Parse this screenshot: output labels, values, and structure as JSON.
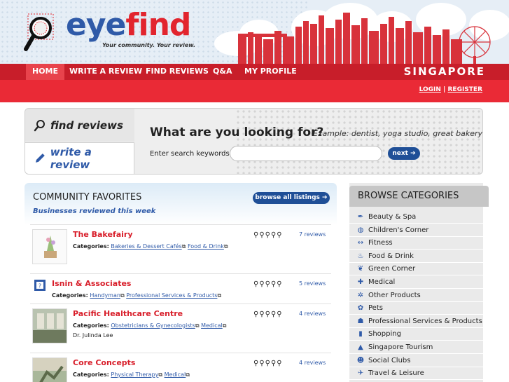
{
  "brand": {
    "logo_eye": "eye",
    "logo_find": "find",
    "tagline": "Your community. Your review.",
    "city": "SINGAPORE"
  },
  "nav": {
    "items": [
      {
        "label": "HOME",
        "active": true
      },
      {
        "label": "WRITE A REVIEW"
      },
      {
        "label": "FIND REVIEWS"
      },
      {
        "label": "Q&A"
      },
      {
        "label": "MY PROFILE"
      }
    ]
  },
  "auth": {
    "login": "LOGIN",
    "separator": "|",
    "register": "REGISTER"
  },
  "search": {
    "tab_find": "find reviews",
    "tab_write": "write a review",
    "heading": "What are you looking for?",
    "example": "Example: dentist, yoga studio, great bakery",
    "keywords_label": "Enter search keywords",
    "input_value": "",
    "next_label": "next ➔"
  },
  "favorites": {
    "title": "COMMUNITY FAVORITES",
    "subtitle": "Businesses reviewed this week",
    "browse_all": "browse all listings ➔",
    "categories_label": "Categories:",
    "listings": [
      {
        "name": "The Bakefairy",
        "categories": [
          "Bakeries & Dessert Cafés",
          "Food & Drink"
        ],
        "extra": "",
        "rating": "⚲⚲⚲⚲⚲",
        "reviews": "7 reviews"
      },
      {
        "name": "Isnin & Associates",
        "categories": [
          "Handyman",
          "Professional Services & Products"
        ],
        "extra": "",
        "rating": "⚲⚲⚲⚲⚲",
        "reviews": "5 reviews"
      },
      {
        "name": "Pacific Healthcare Centre",
        "categories": [
          "Obstetricians & Gynecologists",
          "Medical"
        ],
        "extra": "Dr. Julinda Lee",
        "rating": "⚲⚲⚲⚲⚲",
        "reviews": "4 reviews"
      },
      {
        "name": "Core Concepts",
        "categories": [
          "Physical Therapy",
          "Medical"
        ],
        "extra": "",
        "rating": "⚲⚲⚲⚲⚲",
        "reviews": "4 reviews"
      }
    ]
  },
  "browse": {
    "title": "BROWSE CATEGORIES",
    "items": [
      {
        "label": "Beauty & Spa",
        "icon": "✒",
        "icon_name": "pen-icon"
      },
      {
        "label": "Children's Corner",
        "icon": "◍",
        "icon_name": "ball-icon"
      },
      {
        "label": "Fitness",
        "icon": "↔",
        "icon_name": "dumbbell-icon"
      },
      {
        "label": "Food & Drink",
        "icon": "♨",
        "icon_name": "cutlery-icon"
      },
      {
        "label": "Green Corner",
        "icon": "❦",
        "icon_name": "leaf-icon"
      },
      {
        "label": "Medical",
        "icon": "✚",
        "icon_name": "cross-icon"
      },
      {
        "label": "Other Products",
        "icon": "✲",
        "icon_name": "gear-icon"
      },
      {
        "label": "Pets",
        "icon": "✿",
        "icon_name": "paw-icon"
      },
      {
        "label": "Professional Services & Products",
        "icon": "☗",
        "icon_name": "person-icon"
      },
      {
        "label": "Shopping",
        "icon": "▮",
        "icon_name": "bag-icon"
      },
      {
        "label": "Singapore Tourism",
        "icon": "▲",
        "icon_name": "landmark-icon"
      },
      {
        "label": "Social Clubs",
        "icon": "☻",
        "icon_name": "people-icon"
      },
      {
        "label": "Travel & Leisure",
        "icon": "✈",
        "icon_name": "plane-icon"
      }
    ]
  },
  "colors": {
    "brand_red": "#e2252e",
    "brand_blue": "#2f5aa8",
    "nav_red": "#c81e2a"
  }
}
